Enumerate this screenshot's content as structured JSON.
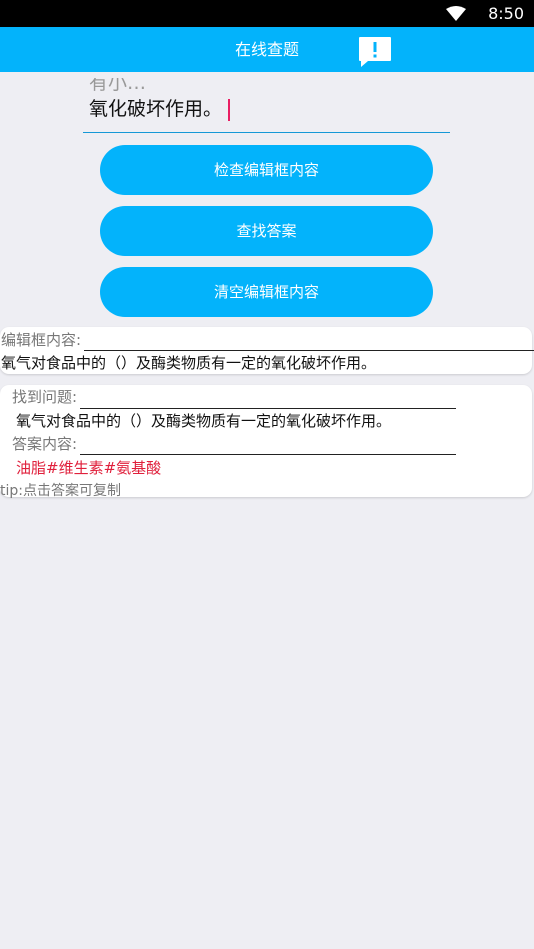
{
  "status_bar": {
    "time": "8:50",
    "wifi_icon": "wifi-icon"
  },
  "app_bar": {
    "title": "在线查题",
    "feedback_icon": "feedback-icon"
  },
  "editor": {
    "previous_line_partial": "有小…",
    "value": "氧化破坏作用。"
  },
  "buttons": {
    "check": "检查编辑框内容",
    "search": "查找答案",
    "clear": "清空编辑框内容"
  },
  "editor_preview": {
    "label": "编辑框内容:",
    "content": "氧气对食品中的（）及酶类物质有一定的氧化破坏作用。"
  },
  "result": {
    "question_label": "找到问题:",
    "question": "氧气对食品中的（）及酶类物质有一定的氧化破坏作用。",
    "answer_label": "答案内容:",
    "answer": "油脂#维生素#氨基酸",
    "tip": "tip:点击答案可复制"
  },
  "colors": {
    "accent": "#03b3fb",
    "answer": "#e0203c",
    "cursor": "#e91e63",
    "background": "#eeeef3"
  }
}
